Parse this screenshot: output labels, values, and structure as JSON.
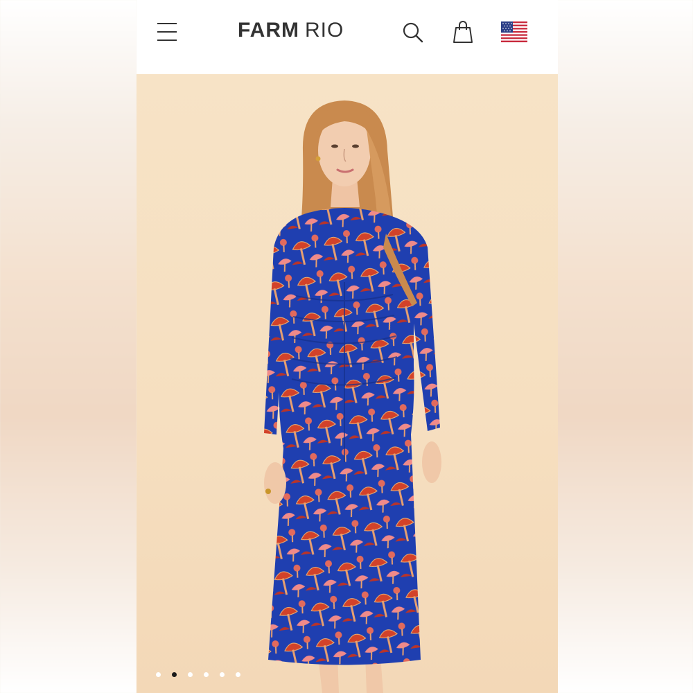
{
  "brand": {
    "bold": "FARM",
    "light": "RIO"
  },
  "header": {
    "menu_icon": "hamburger-menu-icon",
    "search_icon": "search-icon",
    "bag_icon": "shopping-bag-icon",
    "flag_icon": "us-flag-icon"
  },
  "carousel": {
    "total_slides": 6,
    "active_index": 1
  },
  "colors": {
    "background": "#f6dfc0",
    "dress_blue": "#1f3fb0",
    "dress_red": "#d2422a",
    "dress_pink": "#f08a8a",
    "hair": "#c98a4e"
  }
}
